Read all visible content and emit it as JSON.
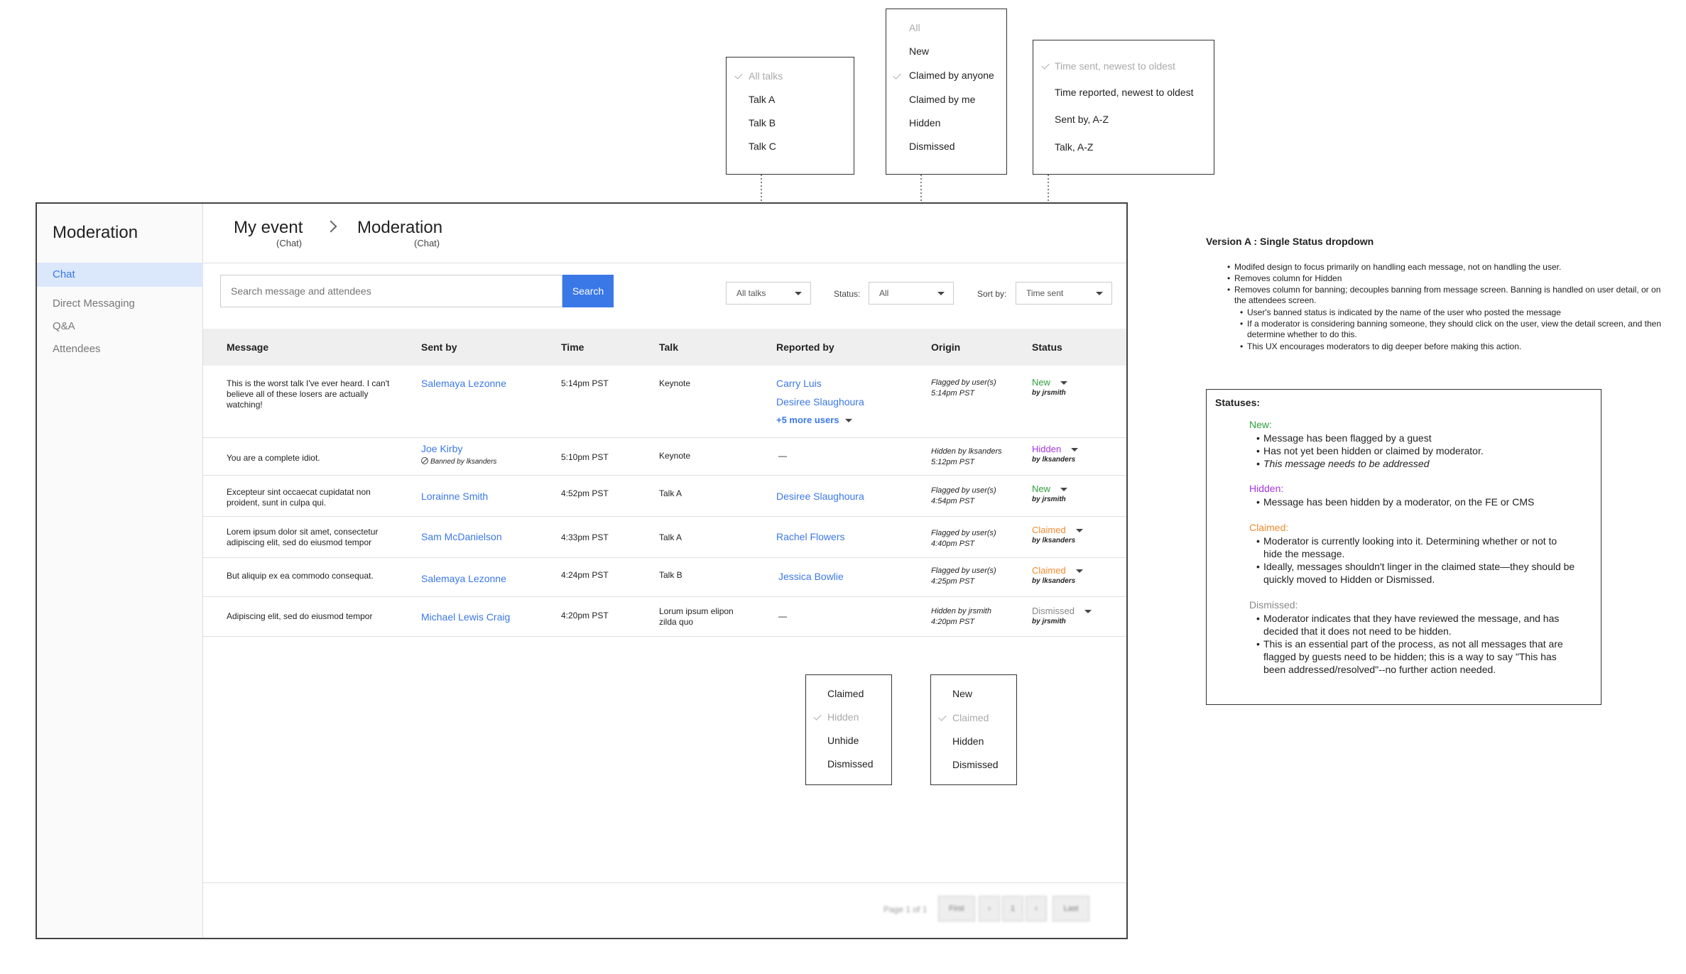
{
  "colors": {
    "accent": "#3b78e7",
    "status_new": "#2e9e3b",
    "status_hidden": "#a335e0",
    "status_claimed": "#f28a2e",
    "status_dismissed": "#888888"
  },
  "sidebar": {
    "title": "Moderation",
    "items": [
      {
        "label": "Chat",
        "active": true
      },
      {
        "label": "Direct Messaging"
      },
      {
        "label": "Q&A"
      },
      {
        "label": "Attendees"
      }
    ]
  },
  "breadcrumb": {
    "event": "My event",
    "event_sub": "(Chat)",
    "page": "Moderation",
    "page_sub": "(Chat)"
  },
  "search": {
    "placeholder": "Search message and attendees",
    "button": "Search"
  },
  "filters": {
    "talk_select": "All talks",
    "status_label": "Status:",
    "status_select": "All",
    "sort_label": "Sort by:",
    "sort_select": "Time sent"
  },
  "table": {
    "headers": [
      "Message",
      "Sent by",
      "Time",
      "Talk",
      "Reported by",
      "Origin",
      "Status"
    ],
    "rows": [
      {
        "message": "This is the worst talk I've ever heard. I can't believe all of these losers are actually watching!",
        "sent_by": "Salemaya Lezonne",
        "time": "5:14pm PST",
        "talk": "Keynote",
        "reported_by": [
          "Carry Luis",
          "Desiree Slaughoura"
        ],
        "more_users": "+5 more users",
        "origin_1": "Flagged by user(s)",
        "origin_2": "5:14pm PST",
        "status": "New",
        "status_by": "by jrsmith"
      },
      {
        "message": "You are a complete idiot.",
        "sent_by": "Joe Kirby",
        "banned": "Banned by lksanders",
        "time": "5:10pm PST",
        "talk": "Keynote",
        "reported_by": [
          "—"
        ],
        "origin_1": "Hidden by lksanders",
        "origin_2": "5:12pm PST",
        "status": "Hidden",
        "status_by": "by lksanders"
      },
      {
        "message": "Excepteur sint occaecat cupidatat non proident, sunt in culpa qui.",
        "sent_by": "Lorainne Smith",
        "time": "4:52pm PST",
        "talk": "Talk A",
        "reported_by": [
          "Desiree Slaughoura"
        ],
        "origin_1": "Flagged by user(s)",
        "origin_2": "4:54pm PST",
        "status": "New",
        "status_by": "by jrsmith"
      },
      {
        "message": "Lorem ipsum dolor sit amet, consectetur adipiscing elit, sed do eiusmod tempor",
        "sent_by": "Sam McDanielson",
        "time": "4:33pm PST",
        "talk": "Talk A",
        "reported_by": [
          "Rachel Flowers"
        ],
        "origin_1": "Flagged by user(s)",
        "origin_2": "4:40pm PST",
        "status": "Claimed",
        "status_by": "by lksanders"
      },
      {
        "message": "But aliquip ex ea commodo consequat.",
        "sent_by": "Salemaya Lezonne",
        "time": "4:24pm PST",
        "talk": "Talk B",
        "reported_by": [
          "Jessica Bowlie"
        ],
        "origin_1": "Flagged by user(s)",
        "origin_2": "4:25pm PST",
        "status": "Claimed",
        "status_by": "by lksanders"
      },
      {
        "message": "Adipiscing elit, sed do eiusmod tempor",
        "sent_by": "Michael Lewis Craig",
        "time": "4:20pm PST",
        "talk": "Lorum ipsum elipon zilda quo",
        "reported_by": [
          "—"
        ],
        "origin_1": "Hidden by jrsmith",
        "origin_2": "4:20pm PST",
        "status": "Dismissed",
        "status_by": "by jrsmith"
      }
    ]
  },
  "pagination": {
    "page_text": "Page 1 of 1",
    "first": "First",
    "prev": "‹",
    "current": "1",
    "next": "›",
    "last": "Last"
  },
  "menus": {
    "talks": [
      "All talks",
      "Talk A",
      "Talk B",
      "Talk C"
    ],
    "status": [
      "All",
      "New",
      "Claimed by anyone",
      "Claimed by me",
      "Hidden",
      "Dismissed"
    ],
    "sort": [
      "Time sent, newest to oldest",
      "Time reported, newest to oldest",
      "Sent by, A-Z",
      "Talk, A-Z"
    ],
    "row_hidden": [
      "Claimed",
      "Hidden",
      "Unhide",
      "Dismissed"
    ],
    "row_claimed": [
      "New",
      "Claimed",
      "Hidden",
      "Dismissed"
    ]
  },
  "notes": {
    "version_title": "Version A :  Single Status dropdown",
    "bullets": [
      "Modifed design to focus primarily on handling each message, not on handling the user.",
      "Removes column for Hidden",
      "Removes column for banning; decouples banning from message screen. Banning is handled on user detail, or on the attendees screen."
    ],
    "sub_bullets": [
      "User's banned status is indicated by the name of the user who posted the message",
      "If a moderator is considering banning someone, they should click on the user, view the detail screen, and then determine whether to do this.",
      "This UX encourages moderators to dig deeper before making this action."
    ],
    "statuses_title": "Statuses:",
    "new_head": "New:",
    "new_items": [
      "Message has been flagged by a guest",
      "Has not yet been hidden or claimed by moderator.",
      "This message needs to be addressed"
    ],
    "hidden_head": "Hidden:",
    "hidden_items": [
      "Message has been hidden by a moderator, on the FE or CMS"
    ],
    "claimed_head": "Claimed:",
    "claimed_items": [
      "Moderator is currently looking into it. Determining whether or not to hide the message.",
      "Ideally, messages shouldn't linger in the claimed state—they should be quickly moved to Hidden or Dismissed."
    ],
    "dismissed_head": "Dismissed:",
    "dismissed_items": [
      "Moderator indicates that they have reviewed the message, and has decided that it does not need to be hidden.",
      "This is an essential part of the process, as not all messages that are flagged by guests need to be hidden; this is a way to say \"This has been addressed/resolved\"--no further action needed."
    ]
  }
}
